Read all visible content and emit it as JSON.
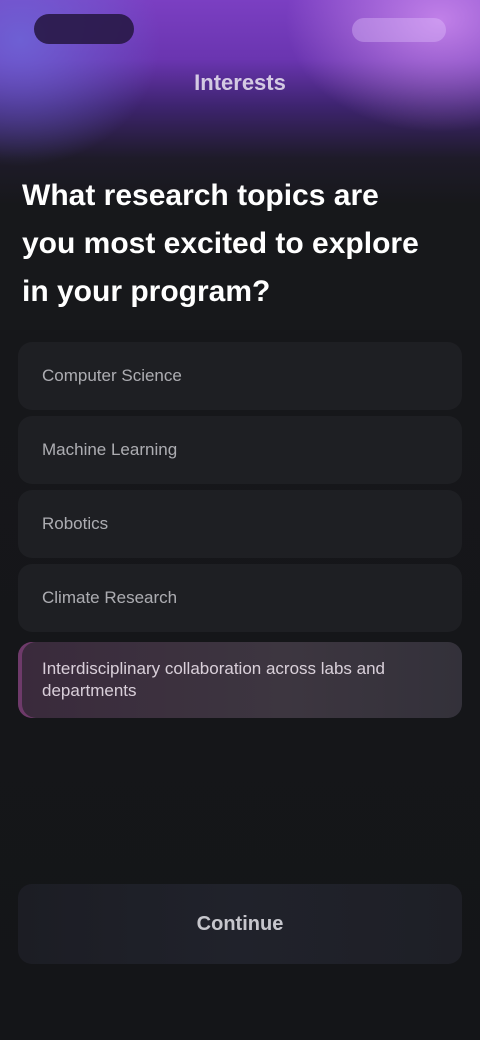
{
  "header": {
    "step_title": "Interests"
  },
  "question": {
    "text": "What research topics are you most excited to explore in your program?"
  },
  "options": [
    {
      "label": "Computer Science"
    },
    {
      "label": "Machine Learning"
    },
    {
      "label": "Robotics"
    },
    {
      "label": "Climate Research"
    },
    {
      "label": "Interdisciplinary collaboration across labs and departments"
    }
  ],
  "footer": {
    "continue_label": "Continue"
  },
  "colors": {
    "accent": "#7b3fc2",
    "background": "#17181b",
    "selected_highlight": "#6e3a6a"
  }
}
